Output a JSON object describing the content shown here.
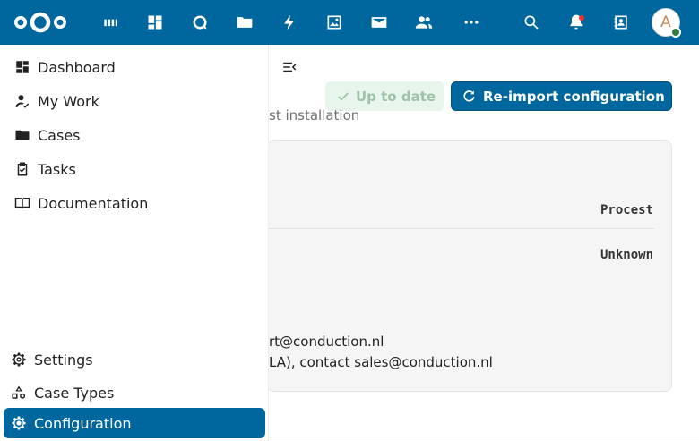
{
  "header": {
    "logo": "nextcloud-logo",
    "apps": [
      {
        "name": "apps-icon"
      },
      {
        "name": "dashboard-icon"
      },
      {
        "name": "talk-icon"
      },
      {
        "name": "files-icon"
      },
      {
        "name": "activity-icon"
      },
      {
        "name": "photos-icon"
      },
      {
        "name": "mail-icon"
      },
      {
        "name": "contacts-icon"
      },
      {
        "name": "more-apps-icon"
      }
    ],
    "search_icon": "search-icon",
    "notifications_icon": "bell-icon",
    "contacts_menu_icon": "contacts-menu-icon",
    "avatar_initial": "A",
    "brand_color": "#00679e"
  },
  "sidebar": {
    "top_items": [
      {
        "label": "Dashboard",
        "icon": "dashboard-icon"
      },
      {
        "label": "My Work",
        "icon": "my-work-icon"
      },
      {
        "label": "Cases",
        "icon": "folder-icon"
      },
      {
        "label": "Tasks",
        "icon": "tasks-icon"
      },
      {
        "label": "Documentation",
        "icon": "book-icon"
      }
    ],
    "bottom_items": [
      {
        "label": "Settings",
        "icon": "gear-icon"
      },
      {
        "label": "Case Types",
        "icon": "shapes-icon"
      },
      {
        "label": "Configuration",
        "icon": "gear-icon",
        "active": true
      }
    ]
  },
  "main": {
    "status_label": "Up to date",
    "reimport_label": "Re-import configuration",
    "subtitle_fragment": "st installation",
    "table_header_fragment": "Procest",
    "table_value": "Unknown",
    "support_line_1": "rt@conduction.nl",
    "support_line_2": "LA), contact sales@conduction.nl"
  }
}
